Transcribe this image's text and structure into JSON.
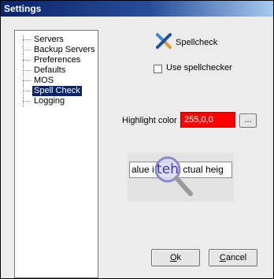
{
  "window": {
    "title": "Settings"
  },
  "tree": {
    "items": [
      {
        "label": "Servers",
        "selected": false
      },
      {
        "label": "Backup Servers",
        "selected": false
      },
      {
        "label": "Preferences",
        "selected": false
      },
      {
        "label": "Defaults",
        "selected": false
      },
      {
        "label": "MOS",
        "selected": false
      },
      {
        "label": "Spell Check",
        "selected": true
      },
      {
        "label": "Logging",
        "selected": false
      }
    ]
  },
  "spellcheck": {
    "title": "Spellcheck",
    "icon": "spellcheck-icon",
    "use_label": "Use spellchecker",
    "use_checked": false
  },
  "highlight": {
    "label": "Highlight color :",
    "value": "255,0,0",
    "color": "#ff0000",
    "browse_label": "..."
  },
  "preview": {
    "left_text": "alue i",
    "right_text": "ctual heig",
    "magnified_word": "teh"
  },
  "buttons": {
    "ok_mnemonic": "O",
    "ok_rest": "k",
    "cancel_mnemonic": "C",
    "cancel_rest": "ancel"
  },
  "colors": {
    "title_bar": "#0a246a",
    "selection": "#0a246a",
    "dialog_bg": "#ececec"
  }
}
